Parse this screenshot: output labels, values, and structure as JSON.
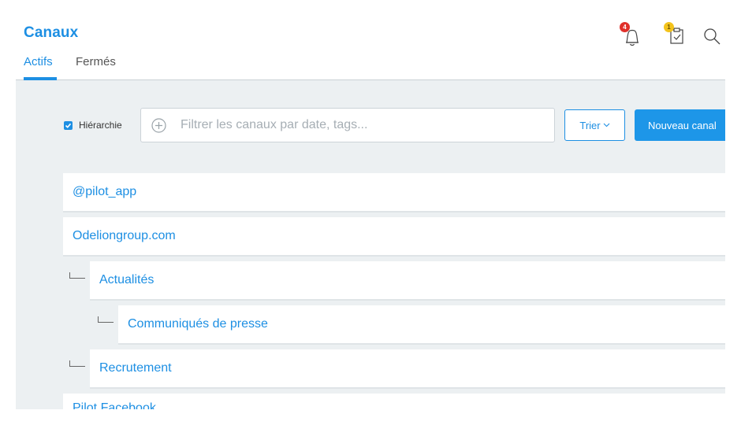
{
  "header": {
    "title": "Canaux",
    "tabs": [
      {
        "label": "Actifs",
        "active": true
      },
      {
        "label": "Fermés",
        "active": false
      }
    ],
    "notifications": {
      "icon": "bell-icon",
      "count": "4",
      "badge_color": "#e0302a"
    },
    "tasks": {
      "icon": "clipboard-check-icon",
      "count": "1",
      "badge_color": "#f3c31c"
    },
    "search": {
      "icon": "search-icon"
    }
  },
  "toolbar": {
    "hierarchy_label": "Hiérarchie",
    "hierarchy_checked": true,
    "filter_placeholder": "Filtrer les canaux par date, tags...",
    "sort_label": "Trier",
    "new_channel_label": "Nouveau canal"
  },
  "channels": [
    {
      "name": "@pilot_app",
      "level": 0
    },
    {
      "name": "Odeliongroup.com",
      "level": 0
    },
    {
      "name": "Actualités",
      "level": 1
    },
    {
      "name": "Communiqués de presse",
      "level": 2
    },
    {
      "name": "Recrutement",
      "level": 1
    },
    {
      "name": "Pilot Facebook",
      "level": 0
    }
  ],
  "colors": {
    "accent": "#1d8fe3",
    "background": "#ecf0f2"
  }
}
